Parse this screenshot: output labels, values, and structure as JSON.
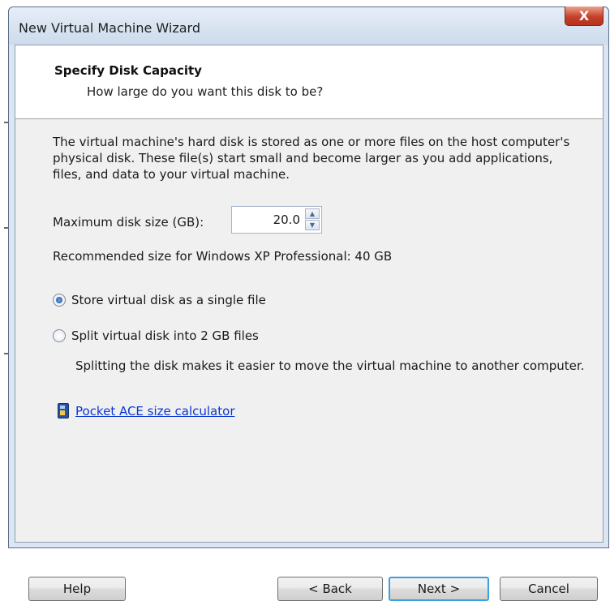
{
  "window": {
    "title": "New Virtual Machine Wizard",
    "close_glyph": "X"
  },
  "header": {
    "title": "Specify Disk Capacity",
    "subtitle": "How large do you want this disk to be?"
  },
  "content": {
    "description": "The virtual machine's hard disk is stored as one or more files on the host computer's physical disk. These file(s) start small and become larger as you add applications, files, and data to your virtual machine.",
    "max_size_label": "Maximum disk size (GB):",
    "max_size_value": "20.0",
    "recommended": "Recommended size for Windows XP Professional: 40 GB",
    "option_single": "Store virtual disk as a single file",
    "option_split": "Split virtual disk into 2 GB files",
    "selected_option": "single",
    "split_note": "Splitting the disk makes it easier to move the virtual machine to another computer.",
    "calculator_link": "Pocket ACE size calculator"
  },
  "buttons": {
    "help": "Help",
    "back": "< Back",
    "next": "Next >",
    "cancel": "Cancel"
  },
  "colors": {
    "close_red": "#c6402a",
    "link_blue": "#0b36d6",
    "default_button_focus": "#3c9fe0"
  }
}
